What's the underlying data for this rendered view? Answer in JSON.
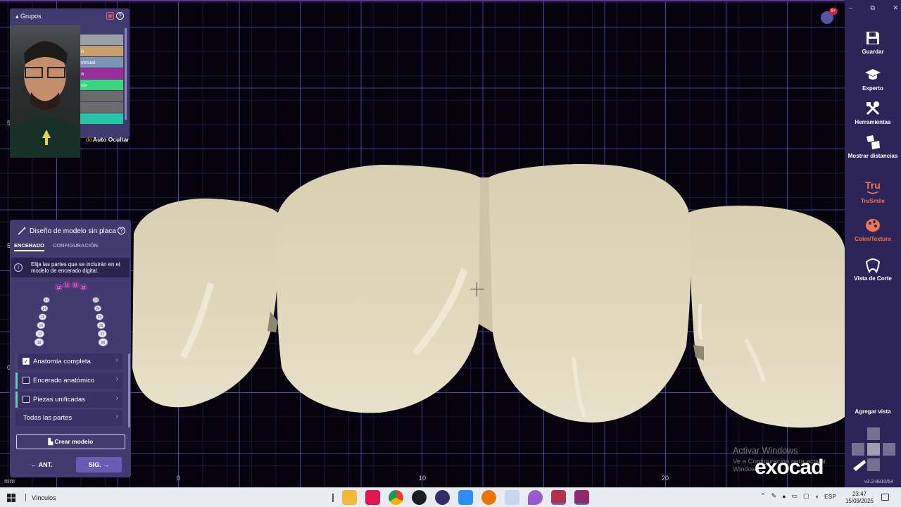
{
  "groups_panel": {
    "title": "Grupos",
    "rows": [
      {
        "label": "",
        "color": "#9aa0a6"
      },
      {
        "label": "o",
        "color": "#c7a06a"
      },
      {
        "label": "virtual",
        "color": "#7c95b6"
      },
      {
        "label": "a",
        "color": "#9a2d9c"
      },
      {
        "label": "co",
        "color": "#3bd780"
      },
      {
        "label": "",
        "color": "#6b6b6b"
      },
      {
        "label": "",
        "color": "#6b6b6b"
      },
      {
        "label": "",
        "color": "#24c7a3"
      }
    ],
    "footer_partial": "do",
    "auto_hide": "Auto Ocultar"
  },
  "design_panel": {
    "title": "Diseño de modelo sin placa",
    "tabs": [
      {
        "label": "ENCERADO",
        "active": true
      },
      {
        "label": "CONFIGURACIÓN",
        "active": false
      }
    ],
    "info": "Elija las partes que se incluirán en el modelo de encerado digital.",
    "tooth_chart": {
      "selected": [
        "12",
        "11",
        "21",
        "22"
      ],
      "upper_left": [
        "13",
        "14",
        "15",
        "16",
        "17",
        "18"
      ],
      "upper_right": [
        "23",
        "24",
        "25",
        "26",
        "27",
        "28"
      ],
      "selected_color": "#8b1e8c"
    },
    "options": [
      {
        "label": "Anatomía completa",
        "checked": true
      },
      {
        "label": "Encerado anatómico",
        "checked": false
      },
      {
        "label": "Piezas unificadas",
        "checked": false
      }
    ],
    "all_parts": "Todas las partes",
    "create_model": "Crear modelo",
    "prev": "ANT.",
    "next": "SIG."
  },
  "viewport": {
    "axis_unit": "mm",
    "x_ticks": [
      "0",
      "10",
      "20"
    ],
    "y_ticks": [
      "5",
      "0",
      "5"
    ],
    "watermark_title": "Activar Windows",
    "watermark_sub": "Ve a Configuración para activar Windows.",
    "brand": "exocad",
    "notification_badge": "9+",
    "model_color": "#e3d9bd"
  },
  "toolbar": {
    "window_controls": [
      "–",
      "⧉",
      "✕"
    ],
    "tools": [
      {
        "label": "Guardar",
        "icon": "save-icon"
      },
      {
        "label": "Experto",
        "icon": "graduation-cap-icon"
      },
      {
        "label": "Herramientas",
        "icon": "tools-icon"
      },
      {
        "label": "Mostrar distancias",
        "icon": "distances-icon"
      },
      {
        "label": "TruSmile",
        "icon": "trusmile-icon"
      },
      {
        "label": "Color/Textura",
        "icon": "palette-icon"
      },
      {
        "label": "Vista de Corte",
        "icon": "tooth-section-icon"
      }
    ],
    "add_view": "Agregar vista",
    "version": "v3.2-8810/64"
  },
  "taskbar": {
    "pinned": "Vínculos",
    "apps": [
      "file-explorer-icon",
      "tiktok-icon",
      "chrome-icon",
      "github-icon",
      "obs-icon",
      "zoom-icon",
      "blender-icon",
      "brush-app-icon",
      "maps-pin-icon",
      "exocad-icon",
      "cad-app-icon"
    ],
    "language": "ESP",
    "time": "23:47",
    "date": "15/09/2025"
  }
}
